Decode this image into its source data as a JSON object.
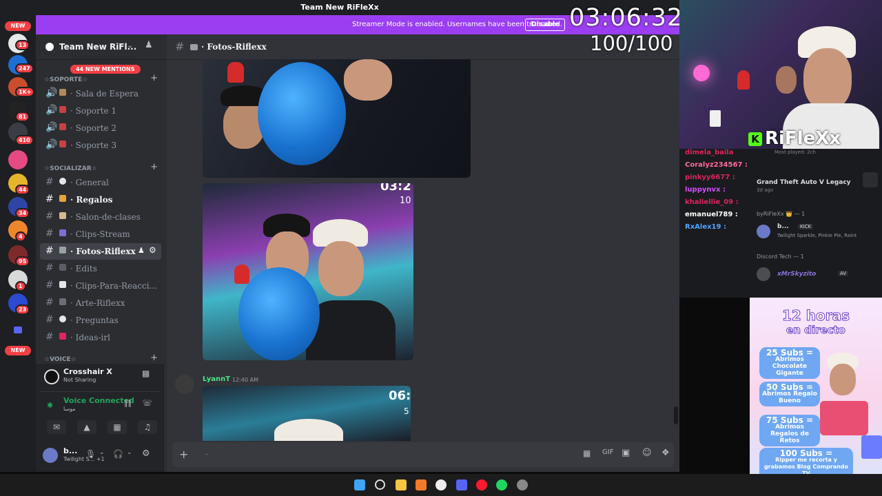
{
  "window": {
    "title": "Team New RiFleXx"
  },
  "streamer_banner": {
    "message": "Streamer Mode is enabled. Usernames have been truncated.",
    "button": "Disable"
  },
  "overlay": {
    "timer": "03:06:32",
    "counter": "100/100",
    "webcam_name": "RiFleXx"
  },
  "server_rail": {
    "new_top": "NEW",
    "new_bottom": "NEW",
    "badges": [
      "13",
      "247",
      "1K+",
      "81",
      "410",
      "44",
      "34",
      "4",
      "95",
      "1",
      "23"
    ]
  },
  "server": {
    "name": "Team New RiFl...",
    "mentions": "44 NEW MENTIONS",
    "categories": [
      {
        "label": "☆SOPORTE☆"
      },
      {
        "label": "☆SOCIALIZAR☆"
      },
      {
        "label": "☆VOICE☆"
      }
    ],
    "support_channels": [
      {
        "label": "· Sala de Espera"
      },
      {
        "label": "· Soporte 1"
      },
      {
        "label": "· Soporte 2"
      },
      {
        "label": "· Soporte 3"
      }
    ],
    "text_channels": [
      {
        "label": "· General"
      },
      {
        "label": "· Regalos"
      },
      {
        "label": "· Salon-de-clases"
      },
      {
        "label": "· Clips-Stream"
      },
      {
        "label": "· Fotos-Riflexx"
      },
      {
        "label": "· Edits"
      },
      {
        "label": "· Clips-Para-Reacci..."
      },
      {
        "label": "· Arte-Riflexx"
      },
      {
        "label": "· Preguntas"
      },
      {
        "label": "· Ideas-irl"
      }
    ]
  },
  "user_panel": {
    "activity_title": "Crosshair X",
    "activity_sub": "Not Sharing",
    "voice_status": "Voice Connected",
    "voice_channel": "موسا",
    "username": "b...",
    "user_status": "Twilight S... +1"
  },
  "channel": {
    "name": "· Fotos-Riflexx",
    "message_author": "LyannT",
    "message_time": "12:40 AM",
    "photo2_timer": "03:2",
    "photo2_counter": "10",
    "photo3_timer": "06:",
    "photo3_counter": "5"
  },
  "stream_chat": [
    {
      "name": "dimela_baila",
      "color": "#e0245e"
    },
    {
      "name": "Coralyz234567 :",
      "color": "#ff6b9e"
    },
    {
      "name": "pinkyy6677 :",
      "color": "#e0245e"
    },
    {
      "name": "luppynvx :",
      "color": "#d14fff"
    },
    {
      "name": "khaliellie_09 :",
      "color": "#e0245e"
    },
    {
      "name": "emanuel789 :",
      "color": "#ffffff"
    },
    {
      "name": "RxAlex19 :",
      "color": "#4fa3ff"
    }
  ],
  "stream_panel": {
    "played": "Most played: 2ch",
    "game": "Grand Theft Auto V Legacy",
    "game_ago": "3d ago",
    "section1": "byRiFleXx 👑 — 1",
    "member1_name": "b...",
    "member1_tag": "KICK",
    "member1_status": "Twilight Sparkle, Pinkie Pie, Raint",
    "section2": "Discord Tech — 1",
    "member2_name": "xMrSkyzito",
    "member2_tag": "AV"
  },
  "promo": {
    "title1": "12 horas",
    "title2": "en directo",
    "tiers": [
      {
        "n": "25 Subs =",
        "t": "Abrimos Chocolate Gigante"
      },
      {
        "n": "50 Subs =",
        "t": "Abrimos Regalo Bueno"
      },
      {
        "n": "75 Subs =",
        "t": "Abrimos Regalos de Retos"
      },
      {
        "n": "100 Subs =",
        "t": "Ripper me recorta y grabamos Blog Comprando TV"
      }
    ]
  },
  "colors": {
    "blurple": "#5865f2",
    "banner": "#9b3ef1",
    "green": "#23a55a",
    "red": "#f23f43"
  }
}
